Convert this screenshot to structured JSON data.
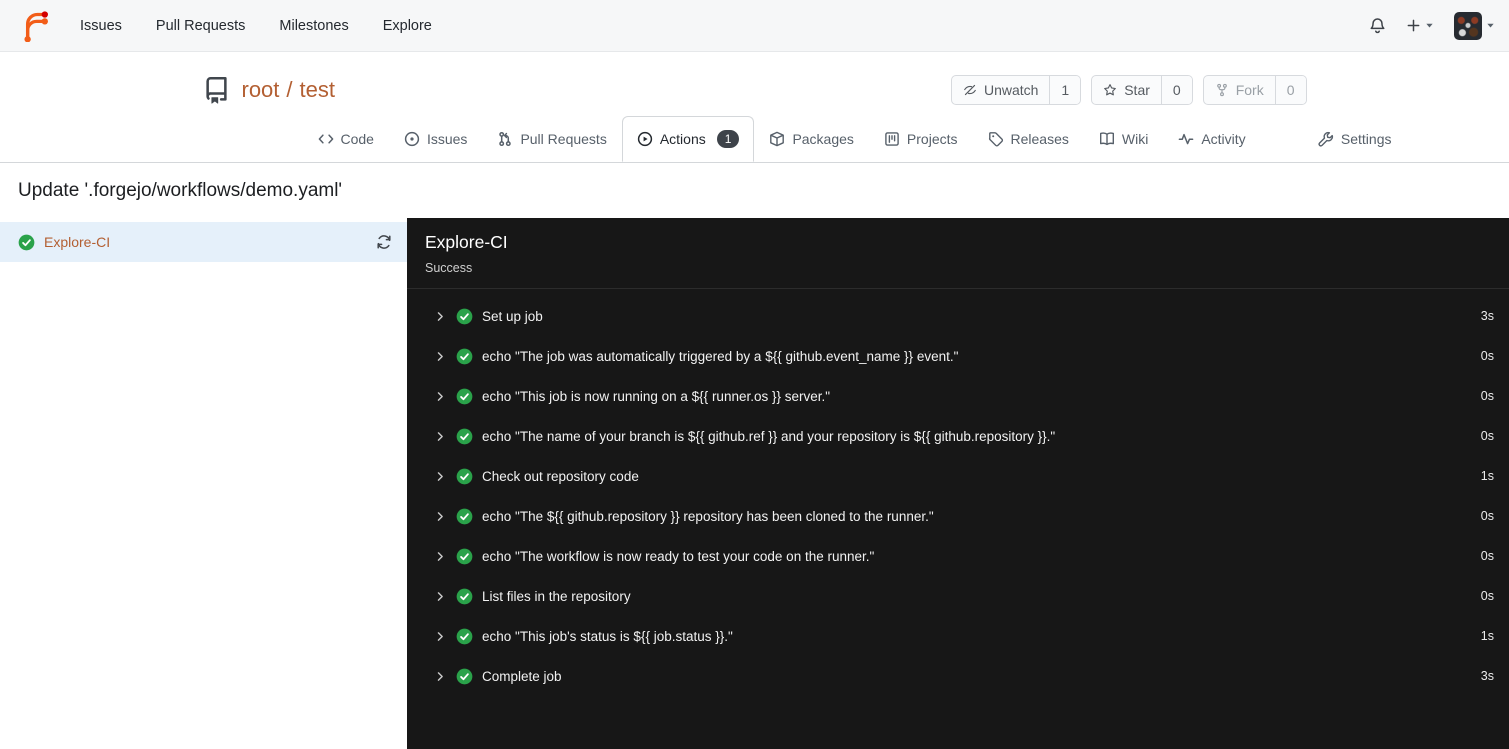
{
  "colors": {
    "accent": "#b35f32",
    "success": "#2aa24a",
    "panel-bg": "#171717",
    "selected-bg": "#e5f0fa",
    "badge-bg": "#3e434a"
  },
  "navbar": {
    "items": [
      {
        "label": "Issues"
      },
      {
        "label": "Pull Requests"
      },
      {
        "label": "Milestones"
      },
      {
        "label": "Explore"
      }
    ]
  },
  "repo": {
    "owner": "root",
    "separator": "/",
    "name": "test",
    "unwatch_label": "Unwatch",
    "unwatch_count": "1",
    "star_label": "Star",
    "star_count": "0",
    "fork_label": "Fork",
    "fork_count": "0"
  },
  "tabs": [
    {
      "label": "Code"
    },
    {
      "label": "Issues"
    },
    {
      "label": "Pull Requests"
    },
    {
      "label": "Actions",
      "badge": "1"
    },
    {
      "label": "Packages"
    },
    {
      "label": "Projects"
    },
    {
      "label": "Releases"
    },
    {
      "label": "Wiki"
    },
    {
      "label": "Activity"
    },
    {
      "label": "Settings"
    }
  ],
  "page": {
    "title": "Update '.forgejo/workflows/demo.yaml'"
  },
  "sidebar": {
    "job": {
      "label": "Explore-CI"
    }
  },
  "run": {
    "title": "Explore-CI",
    "status": "Success",
    "steps": [
      {
        "name": "Set up job",
        "duration": "3s"
      },
      {
        "name": "echo \"The job was automatically triggered by a ${{ github.event_name }} event.\"",
        "duration": "0s"
      },
      {
        "name": "echo \"This job is now running on a ${{ runner.os }} server.\"",
        "duration": "0s"
      },
      {
        "name": "echo \"The name of your branch is ${{ github.ref }} and your repository is ${{ github.repository }}.\"",
        "duration": "0s"
      },
      {
        "name": "Check out repository code",
        "duration": "1s"
      },
      {
        "name": "echo \"The ${{ github.repository }} repository has been cloned to the runner.\"",
        "duration": "0s"
      },
      {
        "name": "echo \"The workflow is now ready to test your code on the runner.\"",
        "duration": "0s"
      },
      {
        "name": "List files in the repository",
        "duration": "0s"
      },
      {
        "name": "echo \"This job's status is ${{ job.status }}.\"",
        "duration": "1s"
      },
      {
        "name": "Complete job",
        "duration": "3s"
      }
    ]
  }
}
